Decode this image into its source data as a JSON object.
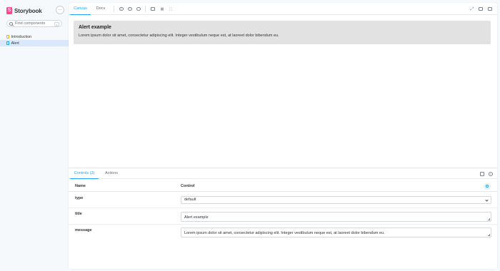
{
  "sidebar": {
    "brand_logo": "S",
    "brand_name": "Storybook",
    "menu_icon": "ellipsis-icon",
    "menu_glyph": "···",
    "search": {
      "placeholder": "Find components",
      "shortcut": "/"
    },
    "items": [
      {
        "label": "Introduction",
        "icon": "document-icon"
      },
      {
        "label": "Alert",
        "icon": "component-icon",
        "selected": true
      }
    ]
  },
  "toolbar": {
    "tabs": [
      {
        "label": "Canvas",
        "active": true
      },
      {
        "label": "Docs",
        "active": false
      }
    ],
    "icons": [
      "zoom-in-icon",
      "zoom-out-icon",
      "zoom-reset-icon",
      "background-icon",
      "grid-icon",
      "outline-icon",
      "fullscreen-icon",
      "share-icon",
      "copy-link-icon"
    ]
  },
  "canvas": {
    "alert": {
      "title": "Alert example",
      "message": "Lorem ipsum dolor sit amet, consectetur adipiscing elit. Integer vestibulum neque est, at laoreet dolor bibendum eu."
    }
  },
  "addons": {
    "tabs": [
      {
        "label": "Controls (3)",
        "active": true
      },
      {
        "label": "Actions",
        "active": false
      }
    ],
    "header": {
      "name": "Name",
      "control": "Control"
    },
    "rows": [
      {
        "name": "type",
        "control": "select",
        "value": "default"
      },
      {
        "name": "title",
        "control": "textarea",
        "value": "Alert example"
      },
      {
        "name": "message",
        "control": "textarea",
        "value": "Lorem ipsum dolor sit amet, consectetur adipiscing elit. Integer vestibulum neque est, at laoreet dolor bibendum eu."
      }
    ]
  },
  "colors": {
    "accent": "#1ea7fd",
    "brand": "#ff4785",
    "alert_bg": "#e2e2e2",
    "selected_bg": "#d9e8fb"
  }
}
